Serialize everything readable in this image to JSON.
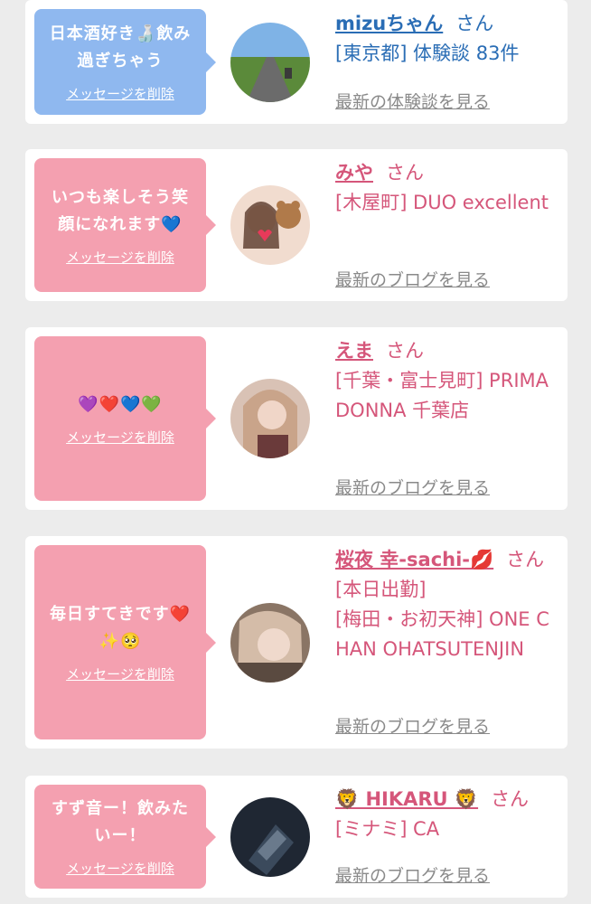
{
  "colors": {
    "bubble_blue": "#8fb8ef",
    "bubble_pink": "#f4a0b0",
    "name_blue": "#2a6db5",
    "name_pink": "#d5567a",
    "link_gray": "#8a8a8a"
  },
  "cards": [
    {
      "message": "日本酒好き🍶飲み過ぎちゃう",
      "delete_label": "メッセージを削除",
      "name": "mizuちゃん",
      "honorific": "さん",
      "detail": "[東京都] 体験談 83件",
      "link": "最新の体験談を見る"
    },
    {
      "message": "いつも楽しそう笑顔になれます💙",
      "delete_label": "メッセージを削除",
      "name": "みや",
      "honorific": "さん",
      "detail": "[木屋町] DUO excellent",
      "link": "最新のブログを見る"
    },
    {
      "message": "💜❤️💙💚",
      "delete_label": "メッセージを削除",
      "name": "えま",
      "honorific": "さん",
      "detail": "[千葉・富士見町] PRIMADONNA 千葉店",
      "link": "最新のブログを見る"
    },
    {
      "message": "毎日すてきです❤️✨🥺",
      "delete_label": "メッセージを削除",
      "name": "桜夜 幸-sachi-💋",
      "honorific": "さん",
      "badge": "[本日出勤]",
      "detail": "[梅田・お初天神] ONE CHAN OHATSUTENJIN",
      "link": "最新のブログを見る"
    },
    {
      "message": "すず音ー！飲みたいー！",
      "delete_label": "メッセージを削除",
      "name": "🦁 HIKARU 🦁",
      "honorific": "さん",
      "detail": "[ミナミ] CA",
      "link": "最新のブログを見る"
    }
  ]
}
